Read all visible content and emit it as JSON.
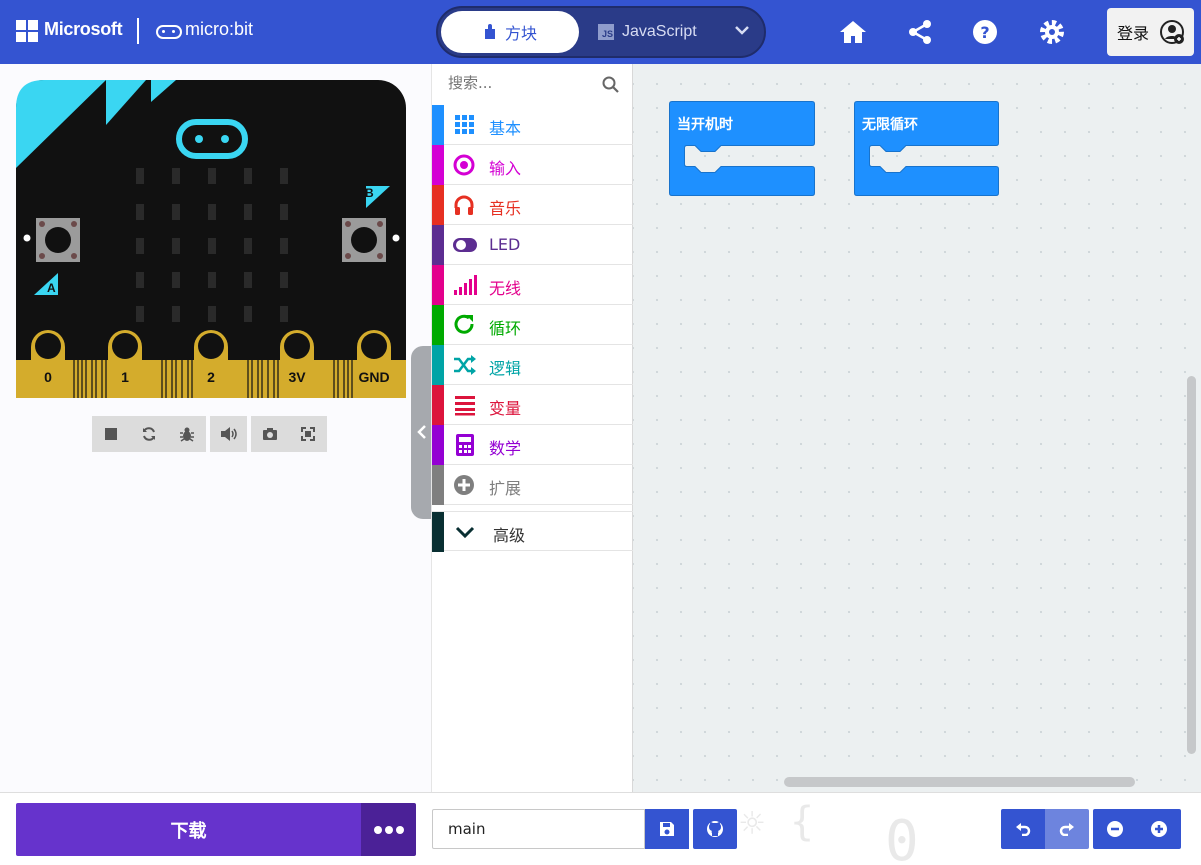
{
  "header": {
    "brand": "Microsoft",
    "product": "micro:bit",
    "tabs": [
      {
        "label": "方块",
        "active": true,
        "icon": "puzzle-icon"
      },
      {
        "label": "JavaScript",
        "active": false,
        "icon": "js-file-icon"
      }
    ],
    "login_label": "登录",
    "actions": [
      "home-icon",
      "share-icon",
      "help-icon",
      "settings-icon"
    ],
    "accent_color": "#3454d1"
  },
  "simulator": {
    "pins": [
      "0",
      "1",
      "2",
      "3V",
      "GND"
    ],
    "buttons": {
      "a": "A",
      "b": "B"
    },
    "toolbar": [
      "stop-icon",
      "restart-icon",
      "debug-icon",
      "mute-icon",
      "screenshot-icon",
      "fullscreen-icon"
    ]
  },
  "toolbox": {
    "search_placeholder": "搜索...",
    "categories": [
      {
        "label": "基本",
        "color": "#1e90ff",
        "icon": "grid-icon"
      },
      {
        "label": "输入",
        "color": "#d400d4",
        "icon": "input-icon"
      },
      {
        "label": "音乐",
        "color": "#e63022",
        "icon": "headphones-icon"
      },
      {
        "label": "LED",
        "color": "#5c2d91",
        "icon": "toggle-icon"
      },
      {
        "label": "无线",
        "color": "#e3008c",
        "icon": "signal-icon"
      },
      {
        "label": "循环",
        "color": "#00aa00",
        "icon": "loop-icon"
      },
      {
        "label": "逻辑",
        "color": "#00a4a6",
        "icon": "shuffle-icon"
      },
      {
        "label": "变量",
        "color": "#dc143c",
        "icon": "lines-icon"
      },
      {
        "label": "数学",
        "color": "#9400d3",
        "icon": "calculator-icon"
      },
      {
        "label": "扩展",
        "color": "#7f7f7f",
        "icon": "plus-circle-icon"
      }
    ],
    "advanced": {
      "label": "高级",
      "color": "#092f32"
    }
  },
  "workspace": {
    "blocks": [
      {
        "label": "当开机时",
        "color": "#1e90ff"
      },
      {
        "label": "无限循环",
        "color": "#1e90ff"
      }
    ]
  },
  "footer": {
    "download_label": "下载",
    "project_name": "main",
    "download_color": "#6633cc"
  }
}
